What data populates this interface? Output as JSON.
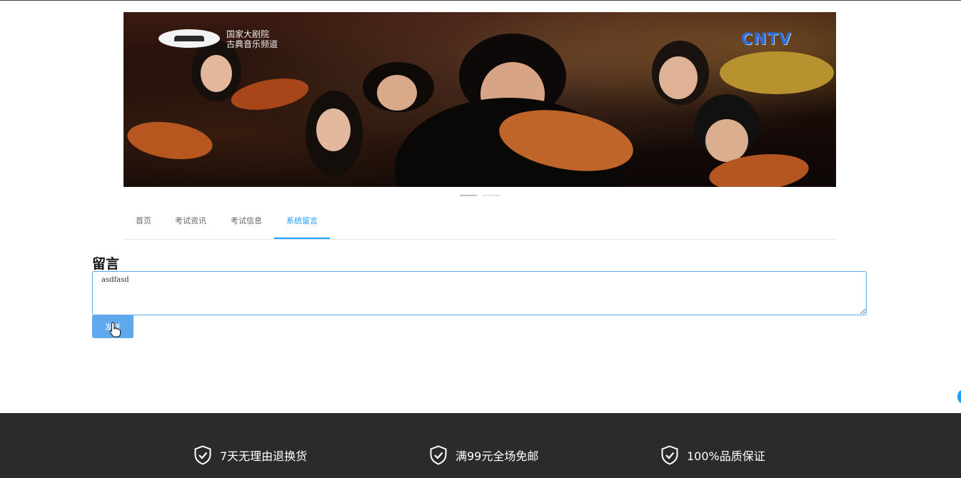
{
  "banner": {
    "logo_line1": "国家大剧院",
    "logo_line2": "古典音乐频道",
    "brand": "CNTV"
  },
  "tabs": [
    {
      "label": "首页"
    },
    {
      "label": "考试资讯"
    },
    {
      "label": "考试信息"
    },
    {
      "label": "系统留言",
      "active": true
    }
  ],
  "message": {
    "title": "留言",
    "value": "asdfasd",
    "send_label": "发送"
  },
  "footer": {
    "features": [
      {
        "label": "7天无理由退换货",
        "icon": "shield-check-icon"
      },
      {
        "label": "满99元全场免邮",
        "icon": "shield-check-icon"
      },
      {
        "label": "100%品质保证",
        "icon": "shield-check-icon"
      }
    ]
  },
  "colors": {
    "accent": "#1e9fff",
    "button": "#5fa8ee",
    "footer_bg": "#2b2b2b"
  }
}
